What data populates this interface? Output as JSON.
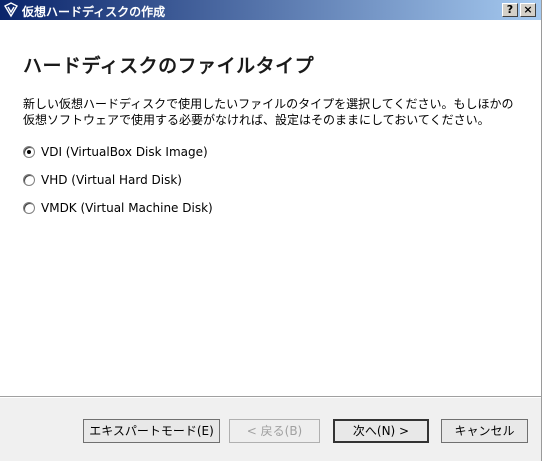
{
  "window": {
    "title": "仮想ハードディスクの作成",
    "help_label": "?",
    "close_label": "×"
  },
  "page": {
    "title": "ハードディスクのファイルタイプ",
    "description_lines": [
      "新しい仮想ハードディスクで使用したいファイルのタイプを選択してください。もしほかの",
      "仮想ソフトウェアで使用する必要がなければ、設定はそのままにしておいてください。"
    ]
  },
  "options": [
    {
      "label": "VDI (VirtualBox Disk Image)",
      "selected": true
    },
    {
      "label": "VHD (Virtual Hard Disk)",
      "selected": false
    },
    {
      "label": "VMDK (Virtual Machine Disk)",
      "selected": false
    }
  ],
  "buttons": {
    "expert": "エキスパートモード(E)",
    "back": "< 戻る(B)",
    "next": "次へ(N) >",
    "cancel": "キャンセル"
  }
}
